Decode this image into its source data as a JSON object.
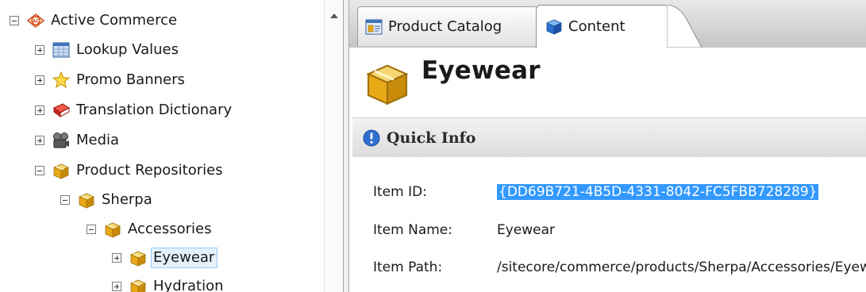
{
  "tree": {
    "items": [
      {
        "label": "Active Commerce",
        "expanded": true,
        "icon": "active-commerce-logo-icon"
      },
      {
        "label": "Lookup Values",
        "expanded": false,
        "icon": "table-icon"
      },
      {
        "label": "Promo Banners",
        "expanded": false,
        "icon": "star-icon"
      },
      {
        "label": "Translation Dictionary",
        "expanded": false,
        "icon": "dictionary-book-icon"
      },
      {
        "label": "Media",
        "expanded": false,
        "icon": "camera-icon"
      },
      {
        "label": "Product Repositories",
        "expanded": true,
        "icon": "box-icon"
      },
      {
        "label": "Sherpa",
        "expanded": true,
        "icon": "box-icon"
      },
      {
        "label": "Accessories",
        "expanded": true,
        "icon": "box-icon"
      },
      {
        "label": "Eyewear",
        "expanded": false,
        "selected": true,
        "icon": "box-icon"
      },
      {
        "label": "Hydration",
        "expanded": false,
        "icon": "box-icon"
      }
    ]
  },
  "tabs": [
    {
      "label": "Product Catalog",
      "active": false,
      "icon": "catalog-icon"
    },
    {
      "label": "Content",
      "active": true,
      "icon": "content-cube-icon"
    }
  ],
  "header": {
    "title": "Eyewear",
    "icon": "box-icon"
  },
  "quick_info": {
    "title": "Quick Info",
    "rows": [
      {
        "key": "Item ID:",
        "value": "{DD69B721-4B5D-4331-8042-FC5FBB728289}"
      },
      {
        "key": "Item Name:",
        "value": "Eyewear"
      },
      {
        "key": "Item Path:",
        "value": "/sitecore/commerce/products/Sherpa/Accessories/Eyewear"
      }
    ]
  },
  "colors": {
    "selection": "#3399ff",
    "tree_selection": "#e4f1fb",
    "box": "#e8a917"
  }
}
